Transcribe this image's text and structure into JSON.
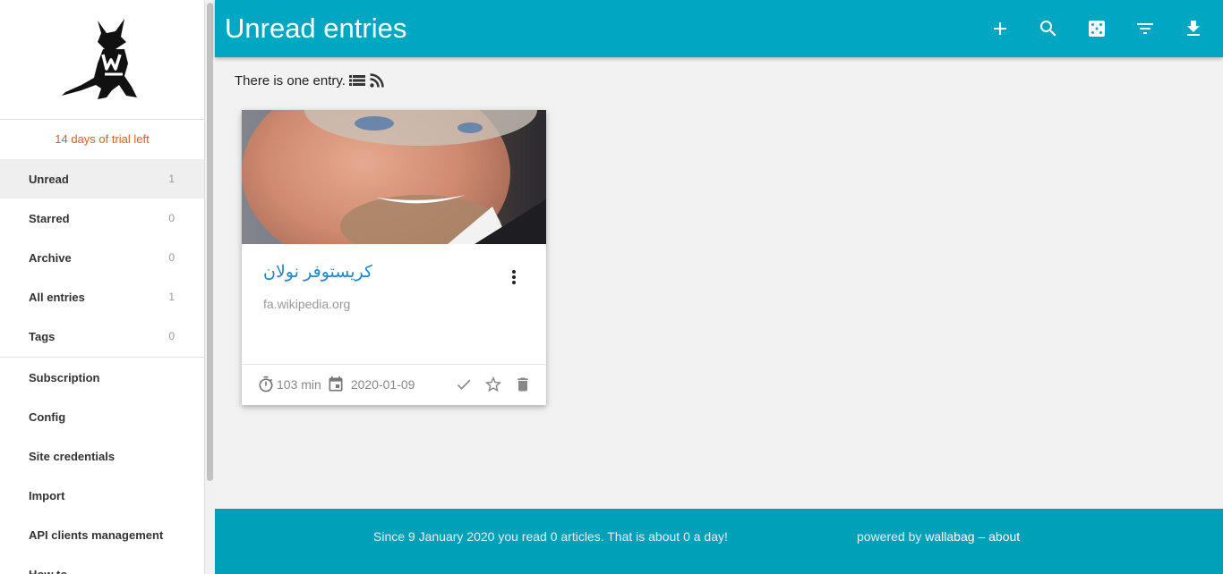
{
  "sidebar": {
    "logo": "wallabag-logo",
    "trial": "14 days of trial left",
    "items": [
      {
        "label": "Unread",
        "count": "1",
        "active": true
      },
      {
        "label": "Starred",
        "count": "0"
      },
      {
        "label": "Archive",
        "count": "0"
      },
      {
        "label": "All entries",
        "count": "1"
      },
      {
        "label": "Tags",
        "count": "0"
      }
    ],
    "links": [
      {
        "label": "Subscription"
      },
      {
        "label": "Config"
      },
      {
        "label": "Site credentials"
      },
      {
        "label": "Import"
      },
      {
        "label": "API clients management"
      },
      {
        "label": "How to"
      }
    ]
  },
  "header": {
    "title": "Unread entries",
    "actions": [
      "add-icon",
      "search-icon",
      "random-icon",
      "filter-icon",
      "download-icon"
    ]
  },
  "main": {
    "entry_count_text": "There is one entry."
  },
  "entry": {
    "title": "کریستوفر نولان",
    "domain": "fa.wikipedia.org",
    "reading_time": "103 min",
    "date": "2020-01-09"
  },
  "footer": {
    "stats": "Since 9 January 2020 you read 0 articles. That is about 0 a day!",
    "powered_prefix": "powered by",
    "powered_link": "wallabag",
    "separator": "–",
    "about_link": "about"
  },
  "colors": {
    "accent": "#00a7c3",
    "footer": "#00a0b8",
    "trial": "#e85b1e",
    "link": "#1e88c7"
  }
}
